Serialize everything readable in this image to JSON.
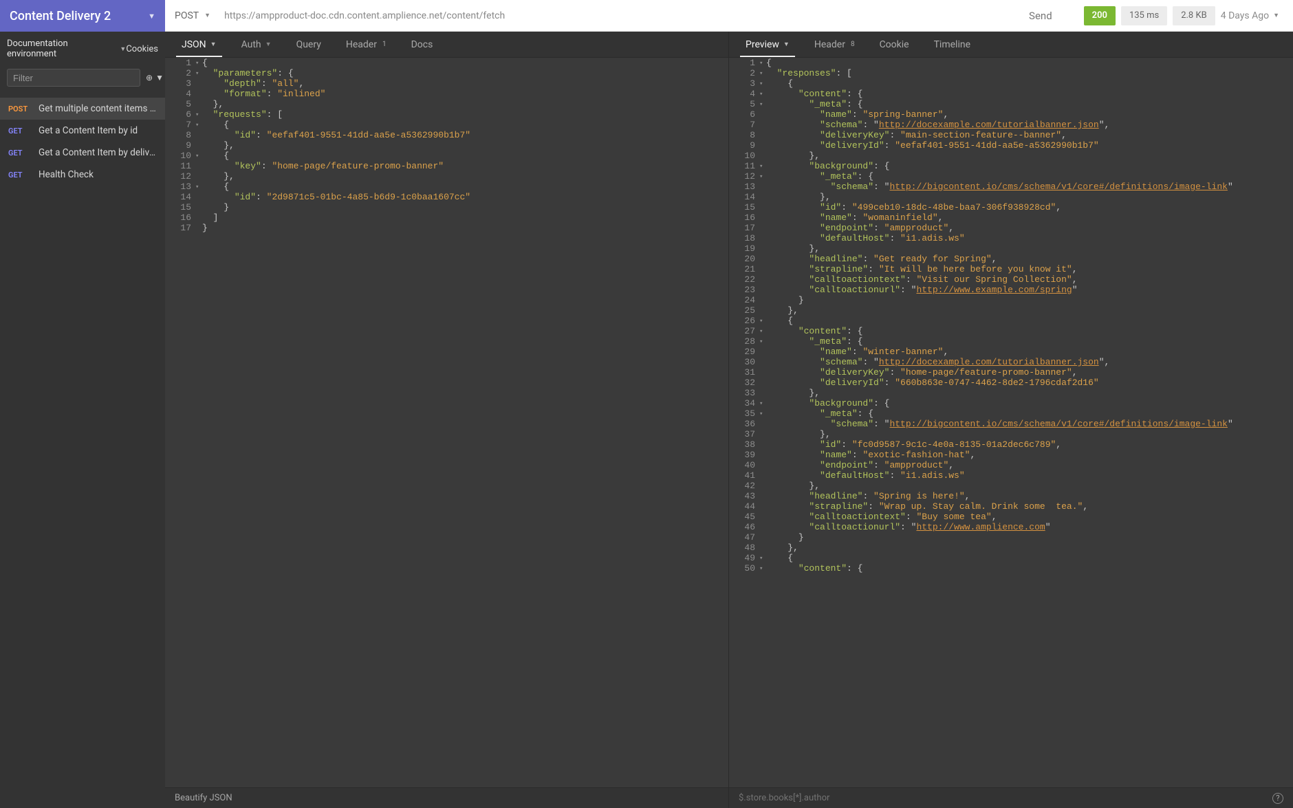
{
  "brand": {
    "title": "Content Delivery 2"
  },
  "topbar": {
    "method": "POST",
    "url": "https://ampproduct-doc.cdn.content.amplience.net/content/fetch",
    "send": "Send",
    "status_code": "200",
    "time": "135 ms",
    "size": "2.8 KB",
    "timestamp": "4 Days Ago"
  },
  "sidebar": {
    "env_label": "Documentation environment",
    "cookies_label": "Cookies",
    "filter_placeholder": "Filter",
    "items": [
      {
        "verb": "POST",
        "verb_class": "post",
        "label": "Get multiple content items by id ...",
        "active": true
      },
      {
        "verb": "GET",
        "verb_class": "get",
        "label": "Get a Content Item by id"
      },
      {
        "verb": "GET",
        "verb_class": "get",
        "label": "Get a Content Item by delivery key"
      },
      {
        "verb": "GET",
        "verb_class": "get",
        "label": "Health Check"
      }
    ]
  },
  "tabs_left": [
    {
      "label": "JSON",
      "active": true,
      "caret": true
    },
    {
      "label": "Auth",
      "caret": true
    },
    {
      "label": "Query"
    },
    {
      "label": "Header",
      "badge": "1"
    },
    {
      "label": "Docs"
    }
  ],
  "tabs_right": [
    {
      "label": "Preview",
      "active": true,
      "caret": true
    },
    {
      "label": "Header",
      "badge": "8"
    },
    {
      "label": "Cookie"
    },
    {
      "label": "Timeline"
    }
  ],
  "footer_left": "Beautify JSON",
  "footer_right": "$.store.books[*].author",
  "request_json": [
    {
      "n": 1,
      "i": 0,
      "f": true,
      "t": [
        [
          "p",
          "{"
        ]
      ]
    },
    {
      "n": 2,
      "i": 1,
      "f": true,
      "t": [
        [
          "k",
          "\"parameters\""
        ],
        [
          "p",
          ": {"
        ]
      ]
    },
    {
      "n": 3,
      "i": 2,
      "t": [
        [
          "k",
          "\"depth\""
        ],
        [
          "p",
          ": "
        ],
        [
          "s",
          "\"all\""
        ],
        [
          "p",
          ","
        ]
      ]
    },
    {
      "n": 4,
      "i": 2,
      "t": [
        [
          "k",
          "\"format\""
        ],
        [
          "p",
          ": "
        ],
        [
          "s",
          "\"inlined\""
        ]
      ]
    },
    {
      "n": 5,
      "i": 1,
      "t": [
        [
          "p",
          "},"
        ]
      ]
    },
    {
      "n": 6,
      "i": 1,
      "f": true,
      "t": [
        [
          "k",
          "\"requests\""
        ],
        [
          "p",
          ": ["
        ]
      ]
    },
    {
      "n": 7,
      "i": 2,
      "f": true,
      "t": [
        [
          "p",
          "{"
        ]
      ]
    },
    {
      "n": 8,
      "i": 3,
      "t": [
        [
          "k",
          "\"id\""
        ],
        [
          "p",
          ": "
        ],
        [
          "s",
          "\"eefaf401-9551-41dd-aa5e-a5362990b1b7\""
        ]
      ]
    },
    {
      "n": 9,
      "i": 2,
      "t": [
        [
          "p",
          "},"
        ]
      ]
    },
    {
      "n": 10,
      "i": 2,
      "f": true,
      "t": [
        [
          "p",
          "{"
        ]
      ]
    },
    {
      "n": 11,
      "i": 3,
      "t": [
        [
          "k",
          "\"key\""
        ],
        [
          "p",
          ": "
        ],
        [
          "s",
          "\"home-page/feature-promo-banner\""
        ]
      ]
    },
    {
      "n": 12,
      "i": 2,
      "t": [
        [
          "p",
          "},"
        ]
      ]
    },
    {
      "n": 13,
      "i": 2,
      "f": true,
      "t": [
        [
          "p",
          "{"
        ]
      ]
    },
    {
      "n": 14,
      "i": 3,
      "t": [
        [
          "k",
          "\"id\""
        ],
        [
          "p",
          ": "
        ],
        [
          "s",
          "\"2d9871c5-01bc-4a85-b6d9-1c0baa1607cc\""
        ]
      ]
    },
    {
      "n": 15,
      "i": 2,
      "t": [
        [
          "p",
          "}"
        ]
      ]
    },
    {
      "n": 16,
      "i": 1,
      "t": [
        [
          "p",
          "]"
        ]
      ]
    },
    {
      "n": 17,
      "i": 0,
      "t": [
        [
          "p",
          "}"
        ]
      ]
    }
  ],
  "response_json": [
    {
      "n": 1,
      "i": 0,
      "f": true,
      "t": [
        [
          "p",
          "{"
        ]
      ]
    },
    {
      "n": 2,
      "i": 1,
      "f": true,
      "t": [
        [
          "k",
          "\"responses\""
        ],
        [
          "p",
          ": ["
        ]
      ]
    },
    {
      "n": 3,
      "i": 2,
      "f": true,
      "t": [
        [
          "p",
          "{"
        ]
      ]
    },
    {
      "n": 4,
      "i": 3,
      "f": true,
      "t": [
        [
          "k",
          "\"content\""
        ],
        [
          "p",
          ": {"
        ]
      ]
    },
    {
      "n": 5,
      "i": 4,
      "f": true,
      "t": [
        [
          "k",
          "\"_meta\""
        ],
        [
          "p",
          ": {"
        ]
      ]
    },
    {
      "n": 6,
      "i": 5,
      "t": [
        [
          "k",
          "\"name\""
        ],
        [
          "p",
          ": "
        ],
        [
          "s",
          "\"spring-banner\""
        ],
        [
          "p",
          ","
        ]
      ]
    },
    {
      "n": 7,
      "i": 5,
      "t": [
        [
          "k",
          "\"schema\""
        ],
        [
          "p",
          ": \""
        ],
        [
          "url",
          "http://docexample.com/tutorialbanner.json"
        ],
        [
          "p",
          "\","
        ]
      ]
    },
    {
      "n": 8,
      "i": 5,
      "t": [
        [
          "k",
          "\"deliveryKey\""
        ],
        [
          "p",
          ": "
        ],
        [
          "s",
          "\"main-section-feature--banner\""
        ],
        [
          "p",
          ","
        ]
      ]
    },
    {
      "n": 9,
      "i": 5,
      "t": [
        [
          "k",
          "\"deliveryId\""
        ],
        [
          "p",
          ": "
        ],
        [
          "s",
          "\"eefaf401-9551-41dd-aa5e-a5362990b1b7\""
        ]
      ]
    },
    {
      "n": 10,
      "i": 4,
      "t": [
        [
          "p",
          "},"
        ]
      ]
    },
    {
      "n": 11,
      "i": 4,
      "f": true,
      "t": [
        [
          "k",
          "\"background\""
        ],
        [
          "p",
          ": {"
        ]
      ]
    },
    {
      "n": 12,
      "i": 5,
      "f": true,
      "t": [
        [
          "k",
          "\"_meta\""
        ],
        [
          "p",
          ": {"
        ]
      ]
    },
    {
      "n": 13,
      "i": 6,
      "t": [
        [
          "k",
          "\"schema\""
        ],
        [
          "p",
          ": \""
        ],
        [
          "url",
          "http://bigcontent.io/cms/schema/v1/core#/definitions/image-link"
        ],
        [
          "p",
          "\""
        ]
      ]
    },
    {
      "n": 14,
      "i": 5,
      "t": [
        [
          "p",
          "},"
        ]
      ]
    },
    {
      "n": 15,
      "i": 5,
      "t": [
        [
          "k",
          "\"id\""
        ],
        [
          "p",
          ": "
        ],
        [
          "s",
          "\"499ceb10-18dc-48be-baa7-306f938928cd\""
        ],
        [
          "p",
          ","
        ]
      ]
    },
    {
      "n": 16,
      "i": 5,
      "t": [
        [
          "k",
          "\"name\""
        ],
        [
          "p",
          ": "
        ],
        [
          "s",
          "\"womaninfield\""
        ],
        [
          "p",
          ","
        ]
      ]
    },
    {
      "n": 17,
      "i": 5,
      "t": [
        [
          "k",
          "\"endpoint\""
        ],
        [
          "p",
          ": "
        ],
        [
          "s",
          "\"ampproduct\""
        ],
        [
          "p",
          ","
        ]
      ]
    },
    {
      "n": 18,
      "i": 5,
      "t": [
        [
          "k",
          "\"defaultHost\""
        ],
        [
          "p",
          ": "
        ],
        [
          "s",
          "\"i1.adis.ws\""
        ]
      ]
    },
    {
      "n": 19,
      "i": 4,
      "t": [
        [
          "p",
          "},"
        ]
      ]
    },
    {
      "n": 20,
      "i": 4,
      "t": [
        [
          "k",
          "\"headline\""
        ],
        [
          "p",
          ": "
        ],
        [
          "s",
          "\"Get ready for Spring\""
        ],
        [
          "p",
          ","
        ]
      ]
    },
    {
      "n": 21,
      "i": 4,
      "t": [
        [
          "k",
          "\"strapline\""
        ],
        [
          "p",
          ": "
        ],
        [
          "s",
          "\"It will be here before you know it\""
        ],
        [
          "p",
          ","
        ]
      ]
    },
    {
      "n": 22,
      "i": 4,
      "t": [
        [
          "k",
          "\"calltoactiontext\""
        ],
        [
          "p",
          ": "
        ],
        [
          "s",
          "\"Visit our Spring Collection\""
        ],
        [
          "p",
          ","
        ]
      ]
    },
    {
      "n": 23,
      "i": 4,
      "t": [
        [
          "k",
          "\"calltoactionurl\""
        ],
        [
          "p",
          ": \""
        ],
        [
          "url",
          "http://www.example.com/spring"
        ],
        [
          "p",
          "\""
        ]
      ]
    },
    {
      "n": 24,
      "i": 3,
      "t": [
        [
          "p",
          "}"
        ]
      ]
    },
    {
      "n": 25,
      "i": 2,
      "t": [
        [
          "p",
          "},"
        ]
      ]
    },
    {
      "n": 26,
      "i": 2,
      "f": true,
      "t": [
        [
          "p",
          "{"
        ]
      ]
    },
    {
      "n": 27,
      "i": 3,
      "f": true,
      "t": [
        [
          "k",
          "\"content\""
        ],
        [
          "p",
          ": {"
        ]
      ]
    },
    {
      "n": 28,
      "i": 4,
      "f": true,
      "t": [
        [
          "k",
          "\"_meta\""
        ],
        [
          "p",
          ": {"
        ]
      ]
    },
    {
      "n": 29,
      "i": 5,
      "t": [
        [
          "k",
          "\"name\""
        ],
        [
          "p",
          ": "
        ],
        [
          "s",
          "\"winter-banner\""
        ],
        [
          "p",
          ","
        ]
      ]
    },
    {
      "n": 30,
      "i": 5,
      "t": [
        [
          "k",
          "\"schema\""
        ],
        [
          "p",
          ": \""
        ],
        [
          "url",
          "http://docexample.com/tutorialbanner.json"
        ],
        [
          "p",
          "\","
        ]
      ]
    },
    {
      "n": 31,
      "i": 5,
      "t": [
        [
          "k",
          "\"deliveryKey\""
        ],
        [
          "p",
          ": "
        ],
        [
          "s",
          "\"home-page/feature-promo-banner\""
        ],
        [
          "p",
          ","
        ]
      ]
    },
    {
      "n": 32,
      "i": 5,
      "t": [
        [
          "k",
          "\"deliveryId\""
        ],
        [
          "p",
          ": "
        ],
        [
          "s",
          "\"660b863e-0747-4462-8de2-1796cdaf2d16\""
        ]
      ]
    },
    {
      "n": 33,
      "i": 4,
      "t": [
        [
          "p",
          "},"
        ]
      ]
    },
    {
      "n": 34,
      "i": 4,
      "f": true,
      "t": [
        [
          "k",
          "\"background\""
        ],
        [
          "p",
          ": {"
        ]
      ]
    },
    {
      "n": 35,
      "i": 5,
      "f": true,
      "t": [
        [
          "k",
          "\"_meta\""
        ],
        [
          "p",
          ": {"
        ]
      ]
    },
    {
      "n": 36,
      "i": 6,
      "t": [
        [
          "k",
          "\"schema\""
        ],
        [
          "p",
          ": \""
        ],
        [
          "url",
          "http://bigcontent.io/cms/schema/v1/core#/definitions/image-link"
        ],
        [
          "p",
          "\""
        ]
      ]
    },
    {
      "n": 37,
      "i": 5,
      "t": [
        [
          "p",
          "},"
        ]
      ]
    },
    {
      "n": 38,
      "i": 5,
      "t": [
        [
          "k",
          "\"id\""
        ],
        [
          "p",
          ": "
        ],
        [
          "s",
          "\"fc0d9587-9c1c-4e0a-8135-01a2dec6c789\""
        ],
        [
          "p",
          ","
        ]
      ]
    },
    {
      "n": 39,
      "i": 5,
      "t": [
        [
          "k",
          "\"name\""
        ],
        [
          "p",
          ": "
        ],
        [
          "s",
          "\"exotic-fashion-hat\""
        ],
        [
          "p",
          ","
        ]
      ]
    },
    {
      "n": 40,
      "i": 5,
      "t": [
        [
          "k",
          "\"endpoint\""
        ],
        [
          "p",
          ": "
        ],
        [
          "s",
          "\"ampproduct\""
        ],
        [
          "p",
          ","
        ]
      ]
    },
    {
      "n": 41,
      "i": 5,
      "t": [
        [
          "k",
          "\"defaultHost\""
        ],
        [
          "p",
          ": "
        ],
        [
          "s",
          "\"i1.adis.ws\""
        ]
      ]
    },
    {
      "n": 42,
      "i": 4,
      "t": [
        [
          "p",
          "},"
        ]
      ]
    },
    {
      "n": 43,
      "i": 4,
      "t": [
        [
          "k",
          "\"headline\""
        ],
        [
          "p",
          ": "
        ],
        [
          "s",
          "\"Spring is here!\""
        ],
        [
          "p",
          ","
        ]
      ]
    },
    {
      "n": 44,
      "i": 4,
      "t": [
        [
          "k",
          "\"strapline\""
        ],
        [
          "p",
          ": "
        ],
        [
          "s",
          "\"Wrap up. Stay calm. Drink some  tea.\""
        ],
        [
          "p",
          ","
        ]
      ]
    },
    {
      "n": 45,
      "i": 4,
      "t": [
        [
          "k",
          "\"calltoactiontext\""
        ],
        [
          "p",
          ": "
        ],
        [
          "s",
          "\"Buy some tea\""
        ],
        [
          "p",
          ","
        ]
      ]
    },
    {
      "n": 46,
      "i": 4,
      "t": [
        [
          "k",
          "\"calltoactionurl\""
        ],
        [
          "p",
          ": \""
        ],
        [
          "url",
          "http://www.amplience.com"
        ],
        [
          "p",
          "\""
        ]
      ]
    },
    {
      "n": 47,
      "i": 3,
      "t": [
        [
          "p",
          "}"
        ]
      ]
    },
    {
      "n": 48,
      "i": 2,
      "t": [
        [
          "p",
          "},"
        ]
      ]
    },
    {
      "n": 49,
      "i": 2,
      "f": true,
      "t": [
        [
          "p",
          "{"
        ]
      ]
    },
    {
      "n": 50,
      "i": 3,
      "f": true,
      "t": [
        [
          "k",
          "\"content\""
        ],
        [
          "p",
          ": {"
        ]
      ]
    }
  ]
}
